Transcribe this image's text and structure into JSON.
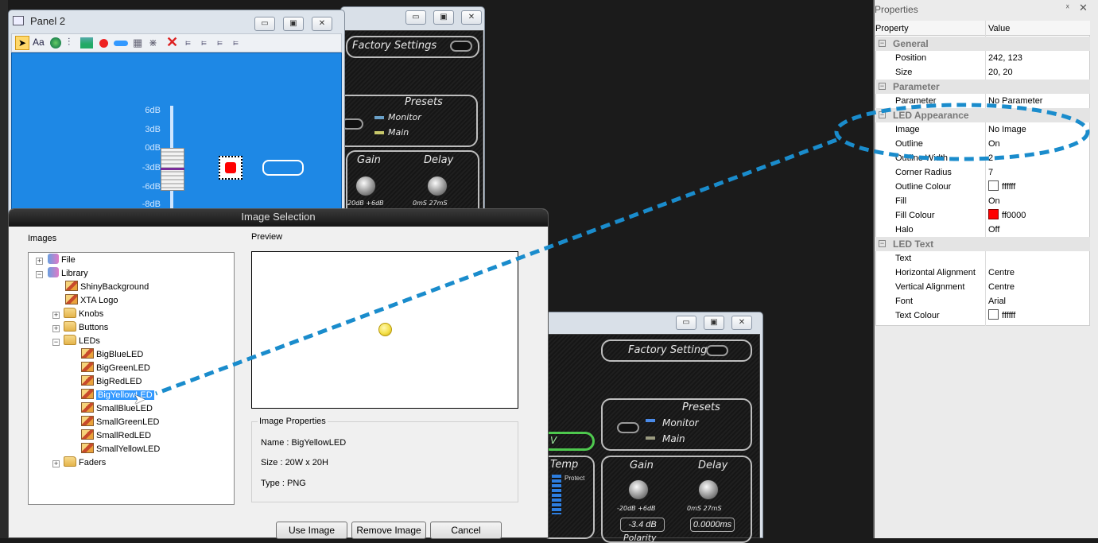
{
  "panel2": {
    "title": "Panel 2",
    "toolbar_font": "Aa",
    "scale": [
      "6dB",
      "3dB",
      "0dB",
      "-3dB",
      "-6dB",
      "-8dB"
    ]
  },
  "hw_top": {
    "factory": "Factory Settings",
    "presets": "Presets",
    "monitor": "Monitor",
    "main": "Main",
    "gain": "Gain",
    "delay": "Delay",
    "gain_range": "20dB +6dB",
    "delay_range": "0mS   27mS"
  },
  "hw_bottom": {
    "factory": "Factory Settings",
    "presets": "Presets",
    "monitor": "Monitor",
    "main": "Main",
    "temp": "Temp",
    "protect": "Protect",
    "gain": "Gain",
    "delay": "Delay",
    "gain_range": "-20dB +6dB",
    "delay_range": "0mS   27mS",
    "gain_value": "-3.4 dB",
    "delay_value": "0.0000ms",
    "polarity": "Polarity"
  },
  "dialog": {
    "title": "Image Selection",
    "images_label": "Images",
    "preview_label": "Preview",
    "tree": [
      {
        "label": "File"
      },
      {
        "label": "Library"
      },
      {
        "label": "ShinyBackground"
      },
      {
        "label": "XTA Logo"
      },
      {
        "label": "Knobs"
      },
      {
        "label": "Buttons"
      },
      {
        "label": "LEDs"
      },
      {
        "label": "BigBlueLED"
      },
      {
        "label": "BigGreenLED"
      },
      {
        "label": "BigRedLED"
      },
      {
        "label": "BigYellowLED"
      },
      {
        "label": "SmallBlueLED"
      },
      {
        "label": "SmallGreenLED"
      },
      {
        "label": "SmallRedLED"
      },
      {
        "label": "SmallYellowLED"
      },
      {
        "label": "Faders"
      }
    ],
    "props_title": "Image Properties",
    "name": "Name : BigYellowLED",
    "size": "Size : 20W x 20H",
    "type": "Type : PNG",
    "use_image": "Use Image",
    "remove_image": "Remove Image",
    "cancel": "Cancel"
  },
  "properties": {
    "title": "Properties",
    "pin": "p X",
    "col_property": "Property",
    "col_value": "Value",
    "cat_general": "General",
    "position_k": "Position",
    "position_v": "242, 123",
    "size_k": "Size",
    "size_v": "20, 20",
    "cat_parameter": "Parameter",
    "parameter_k": "Parameter",
    "parameter_v": "No Parameter",
    "cat_led": "LED Appearance",
    "image_k": "Image",
    "image_v": "No Image",
    "outline_k": "Outline",
    "outline_v": "On",
    "outline_w_k": "Outline Width",
    "outline_w_v": "2",
    "corner_k": "Corner Radius",
    "corner_v": "7",
    "outline_c_k": "Outline Colour",
    "outline_c_v": "ffffff",
    "fill_k": "Fill",
    "fill_v": "On",
    "fill_c_k": "Fill Colour",
    "fill_c_v": "ff0000",
    "halo_k": "Halo",
    "halo_v": "Off",
    "cat_text": "LED Text",
    "text_k": "Text",
    "text_v": "",
    "halign_k": "Horizontal Alignment",
    "halign_v": "Centre",
    "valign_k": "Vertical Alignment",
    "valign_v": "Centre",
    "font_k": "Font",
    "font_v": "Arial",
    "text_c_k": "Text Colour",
    "text_c_v": "ffffff"
  },
  "colors": {
    "accent": "#1a8ccc",
    "panel_blue": "#1e88e5",
    "led_red": "#ff0000",
    "led_yellow": "#f4e04a"
  }
}
